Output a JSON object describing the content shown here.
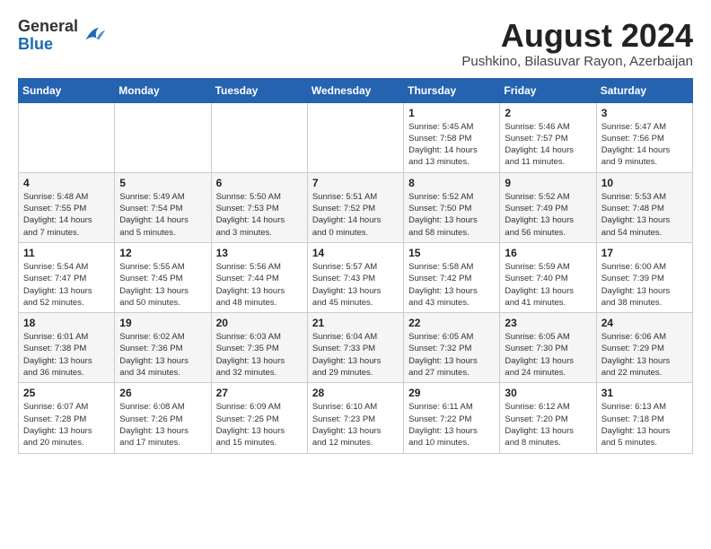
{
  "header": {
    "logo_general": "General",
    "logo_blue": "Blue",
    "month_year": "August 2024",
    "location": "Pushkino, Bilasuvar Rayon, Azerbaijan"
  },
  "days_of_week": [
    "Sunday",
    "Monday",
    "Tuesday",
    "Wednesday",
    "Thursday",
    "Friday",
    "Saturday"
  ],
  "weeks": [
    [
      {
        "day": "",
        "info": ""
      },
      {
        "day": "",
        "info": ""
      },
      {
        "day": "",
        "info": ""
      },
      {
        "day": "",
        "info": ""
      },
      {
        "day": "1",
        "info": "Sunrise: 5:45 AM\nSunset: 7:58 PM\nDaylight: 14 hours\nand 13 minutes."
      },
      {
        "day": "2",
        "info": "Sunrise: 5:46 AM\nSunset: 7:57 PM\nDaylight: 14 hours\nand 11 minutes."
      },
      {
        "day": "3",
        "info": "Sunrise: 5:47 AM\nSunset: 7:56 PM\nDaylight: 14 hours\nand 9 minutes."
      }
    ],
    [
      {
        "day": "4",
        "info": "Sunrise: 5:48 AM\nSunset: 7:55 PM\nDaylight: 14 hours\nand 7 minutes."
      },
      {
        "day": "5",
        "info": "Sunrise: 5:49 AM\nSunset: 7:54 PM\nDaylight: 14 hours\nand 5 minutes."
      },
      {
        "day": "6",
        "info": "Sunrise: 5:50 AM\nSunset: 7:53 PM\nDaylight: 14 hours\nand 3 minutes."
      },
      {
        "day": "7",
        "info": "Sunrise: 5:51 AM\nSunset: 7:52 PM\nDaylight: 14 hours\nand 0 minutes."
      },
      {
        "day": "8",
        "info": "Sunrise: 5:52 AM\nSunset: 7:50 PM\nDaylight: 13 hours\nand 58 minutes."
      },
      {
        "day": "9",
        "info": "Sunrise: 5:52 AM\nSunset: 7:49 PM\nDaylight: 13 hours\nand 56 minutes."
      },
      {
        "day": "10",
        "info": "Sunrise: 5:53 AM\nSunset: 7:48 PM\nDaylight: 13 hours\nand 54 minutes."
      }
    ],
    [
      {
        "day": "11",
        "info": "Sunrise: 5:54 AM\nSunset: 7:47 PM\nDaylight: 13 hours\nand 52 minutes."
      },
      {
        "day": "12",
        "info": "Sunrise: 5:55 AM\nSunset: 7:45 PM\nDaylight: 13 hours\nand 50 minutes."
      },
      {
        "day": "13",
        "info": "Sunrise: 5:56 AM\nSunset: 7:44 PM\nDaylight: 13 hours\nand 48 minutes."
      },
      {
        "day": "14",
        "info": "Sunrise: 5:57 AM\nSunset: 7:43 PM\nDaylight: 13 hours\nand 45 minutes."
      },
      {
        "day": "15",
        "info": "Sunrise: 5:58 AM\nSunset: 7:42 PM\nDaylight: 13 hours\nand 43 minutes."
      },
      {
        "day": "16",
        "info": "Sunrise: 5:59 AM\nSunset: 7:40 PM\nDaylight: 13 hours\nand 41 minutes."
      },
      {
        "day": "17",
        "info": "Sunrise: 6:00 AM\nSunset: 7:39 PM\nDaylight: 13 hours\nand 38 minutes."
      }
    ],
    [
      {
        "day": "18",
        "info": "Sunrise: 6:01 AM\nSunset: 7:38 PM\nDaylight: 13 hours\nand 36 minutes."
      },
      {
        "day": "19",
        "info": "Sunrise: 6:02 AM\nSunset: 7:36 PM\nDaylight: 13 hours\nand 34 minutes."
      },
      {
        "day": "20",
        "info": "Sunrise: 6:03 AM\nSunset: 7:35 PM\nDaylight: 13 hours\nand 32 minutes."
      },
      {
        "day": "21",
        "info": "Sunrise: 6:04 AM\nSunset: 7:33 PM\nDaylight: 13 hours\nand 29 minutes."
      },
      {
        "day": "22",
        "info": "Sunrise: 6:05 AM\nSunset: 7:32 PM\nDaylight: 13 hours\nand 27 minutes."
      },
      {
        "day": "23",
        "info": "Sunrise: 6:05 AM\nSunset: 7:30 PM\nDaylight: 13 hours\nand 24 minutes."
      },
      {
        "day": "24",
        "info": "Sunrise: 6:06 AM\nSunset: 7:29 PM\nDaylight: 13 hours\nand 22 minutes."
      }
    ],
    [
      {
        "day": "25",
        "info": "Sunrise: 6:07 AM\nSunset: 7:28 PM\nDaylight: 13 hours\nand 20 minutes."
      },
      {
        "day": "26",
        "info": "Sunrise: 6:08 AM\nSunset: 7:26 PM\nDaylight: 13 hours\nand 17 minutes."
      },
      {
        "day": "27",
        "info": "Sunrise: 6:09 AM\nSunset: 7:25 PM\nDaylight: 13 hours\nand 15 minutes."
      },
      {
        "day": "28",
        "info": "Sunrise: 6:10 AM\nSunset: 7:23 PM\nDaylight: 13 hours\nand 12 minutes."
      },
      {
        "day": "29",
        "info": "Sunrise: 6:11 AM\nSunset: 7:22 PM\nDaylight: 13 hours\nand 10 minutes."
      },
      {
        "day": "30",
        "info": "Sunrise: 6:12 AM\nSunset: 7:20 PM\nDaylight: 13 hours\nand 8 minutes."
      },
      {
        "day": "31",
        "info": "Sunrise: 6:13 AM\nSunset: 7:18 PM\nDaylight: 13 hours\nand 5 minutes."
      }
    ]
  ]
}
